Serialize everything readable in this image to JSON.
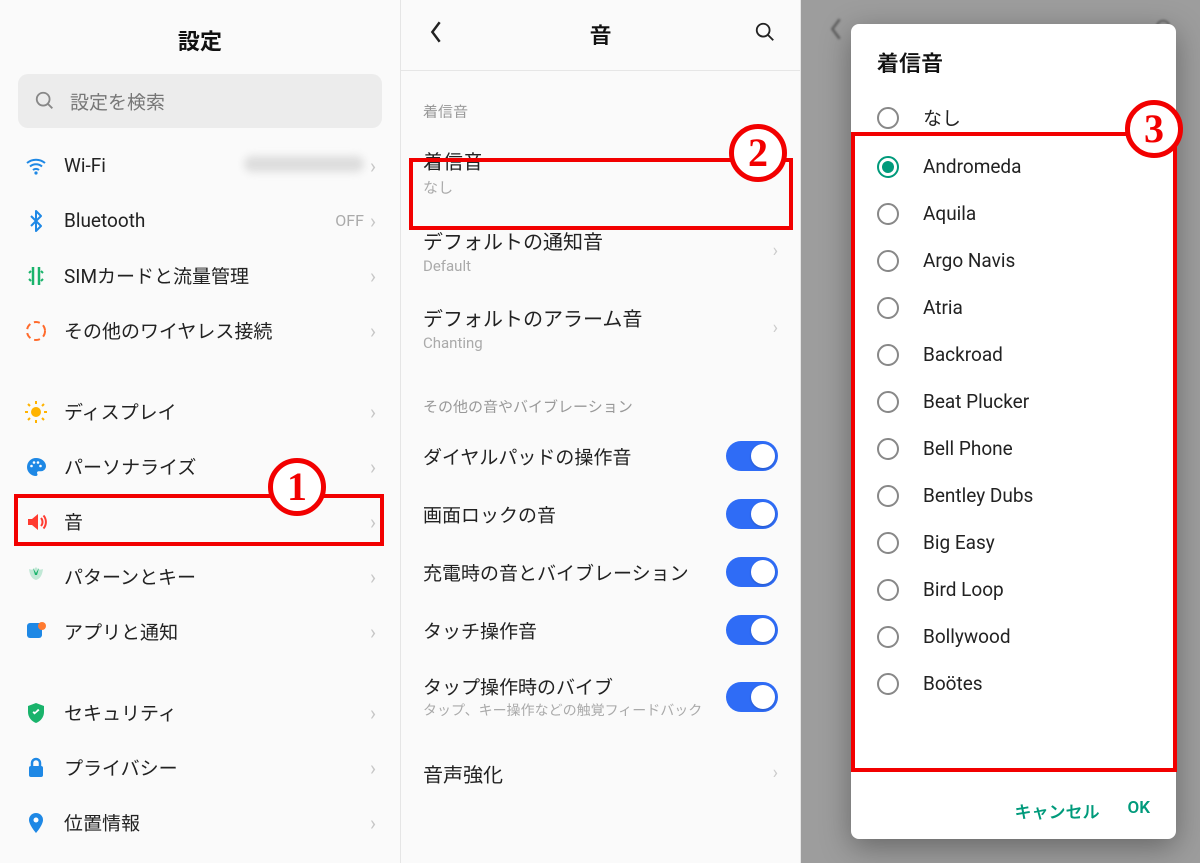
{
  "panel1": {
    "title": "設定",
    "search_placeholder": "設定を検索",
    "items_a": [
      {
        "icon": "wifi",
        "color": "#1e88e5",
        "label": "Wi-Fi",
        "value": "__blur__"
      },
      {
        "icon": "bluetooth",
        "color": "#1e88e5",
        "label": "Bluetooth",
        "value": "OFF"
      },
      {
        "icon": "sim",
        "color": "#19b36b",
        "label": "SIMカードと流量管理",
        "value": ""
      },
      {
        "icon": "wireless",
        "color": "#ff6a2b",
        "label": "その他のワイヤレス接続",
        "value": ""
      }
    ],
    "items_b": [
      {
        "icon": "display",
        "color": "#ffb300",
        "label": "ディスプレイ"
      },
      {
        "icon": "personalize",
        "color": "#1e88e5",
        "label": "パーソナライズ"
      },
      {
        "icon": "sound",
        "color": "#ff3b30",
        "label": "音"
      },
      {
        "icon": "pattern",
        "color": "#19b36b",
        "label": "パターンとキー"
      },
      {
        "icon": "apps",
        "color": "#1e88e5",
        "label": "アプリと通知"
      }
    ],
    "items_c": [
      {
        "icon": "security",
        "color": "#19b36b",
        "label": "セキュリティ"
      },
      {
        "icon": "privacy",
        "color": "#1e88e5",
        "label": "プライバシー"
      },
      {
        "icon": "location",
        "color": "#1e88e5",
        "label": "位置情報"
      }
    ]
  },
  "panel2": {
    "title": "音",
    "section1": "着信音",
    "rows1": [
      {
        "title": "着信音",
        "sub": "なし"
      },
      {
        "title": "デフォルトの通知音",
        "sub": "Default"
      },
      {
        "title": "デフォルトのアラーム音",
        "sub": "Chanting"
      }
    ],
    "section2": "その他の音やバイブレーション",
    "toggles": [
      {
        "title": "ダイヤルパッドの操作音",
        "sub": ""
      },
      {
        "title": "画面ロックの音",
        "sub": ""
      },
      {
        "title": "充電時の音とバイブレーション",
        "sub": ""
      },
      {
        "title": "タッチ操作音",
        "sub": ""
      },
      {
        "title": "タップ操作時のバイブ",
        "sub": "タップ、キー操作などの触覚フィードバック"
      }
    ],
    "last_row": "音声強化"
  },
  "panel3": {
    "dialog_title": "着信音",
    "options": [
      {
        "label": "なし",
        "checked": false
      },
      {
        "label": "Andromeda",
        "checked": true
      },
      {
        "label": "Aquila",
        "checked": false
      },
      {
        "label": "Argo Navis",
        "checked": false
      },
      {
        "label": "Atria",
        "checked": false
      },
      {
        "label": "Backroad",
        "checked": false
      },
      {
        "label": "Beat Plucker",
        "checked": false
      },
      {
        "label": "Bell Phone",
        "checked": false
      },
      {
        "label": "Bentley Dubs",
        "checked": false
      },
      {
        "label": "Big Easy",
        "checked": false
      },
      {
        "label": "Bird Loop",
        "checked": false
      },
      {
        "label": "Bollywood",
        "checked": false
      },
      {
        "label": "Boötes",
        "checked": false
      }
    ],
    "cancel": "キャンセル",
    "ok": "OK"
  },
  "callouts": {
    "n1": "1",
    "n2": "2",
    "n3": "3"
  }
}
